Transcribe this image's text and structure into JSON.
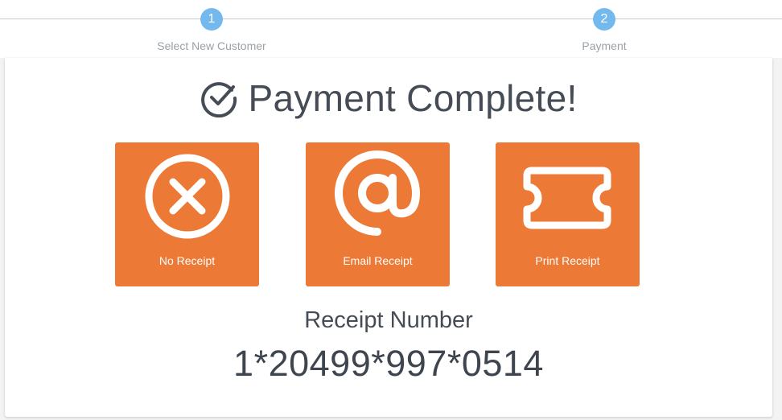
{
  "stepper": {
    "steps": [
      {
        "number": "1",
        "label": "Select New Customer"
      },
      {
        "number": "2",
        "label": "Payment"
      }
    ]
  },
  "main": {
    "title": "Payment Complete!",
    "title_icon": "check-circle-icon",
    "options": [
      {
        "label": "No Receipt",
        "icon": "x-circle-icon"
      },
      {
        "label": "Email Receipt",
        "icon": "at-sign-icon"
      },
      {
        "label": "Print Receipt",
        "icon": "ticket-icon"
      }
    ],
    "receipt_label": "Receipt Number",
    "receipt_number": "1*20499*997*0514"
  },
  "colors": {
    "accent": "#ec7935",
    "step": "#74b9ee",
    "text": "#454c55"
  }
}
